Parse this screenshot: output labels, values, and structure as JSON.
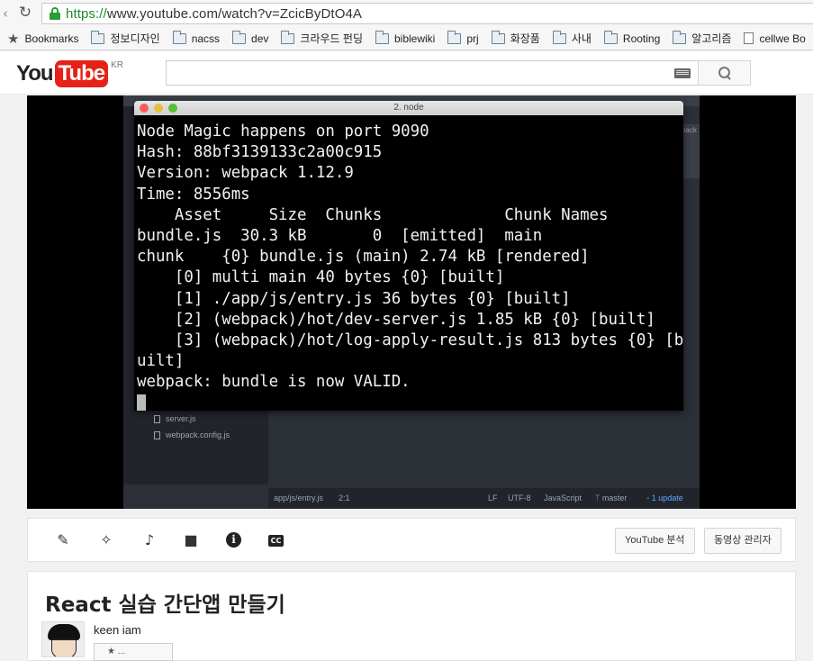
{
  "browser": {
    "url_scheme": "https://",
    "url_rest": "www.youtube.com/watch?v=ZcicByDtO4A",
    "bookmarks": [
      "Bookmarks",
      "정보디자인",
      "nacss",
      "dev",
      "크라우드 펀딩",
      "biblewiki",
      "prj",
      "화장품",
      "사내",
      "Rooting",
      "알고리즘",
      "cellwe Bo"
    ]
  },
  "header": {
    "logo_you": "You",
    "logo_tube": "Tube",
    "region": "KR",
    "search_value": ""
  },
  "video": {
    "terminal_title": "2. node",
    "terminal_lines": [
      "Node Magic happens on port 9090",
      "Hash: 88bf3139133c2a00c915",
      "Version: webpack 1.12.9",
      "Time: 8556ms",
      "    Asset     Size  Chunks             Chunk Names",
      "bundle.js  30.3 kB       0  [emitted]  main",
      "chunk    {0} bundle.js (main) 2.74 kB [rendered]",
      "    [0] multi main 40 bytes {0} [built]",
      "    [1] ./app/js/entry.js 36 bytes {0} [built]",
      "    [2] (webpack)/hot/dev-server.js 1.85 kB {0} [built]",
      "    [3] (webpack)/hot/log-apply-result.js 813 bytes {0} [b",
      "uilt]",
      "webpack: bundle is now VALID."
    ],
    "editor_files": [
      "server.js",
      "webpack.config.js"
    ],
    "status": {
      "path": "app/js/entry.js",
      "pos": "2:1",
      "eol": "LF",
      "encoding": "UTF-8",
      "lang": "JavaScript",
      "branch": "master",
      "update": "1 update"
    },
    "side_tab": "pack"
  },
  "actions": {
    "analytics": "YouTube 분석",
    "manager": "동영상 관리자"
  },
  "info": {
    "title": "React 실습 간단앱 만들기",
    "channel": "keen iam",
    "subscribe": "★ ..."
  }
}
